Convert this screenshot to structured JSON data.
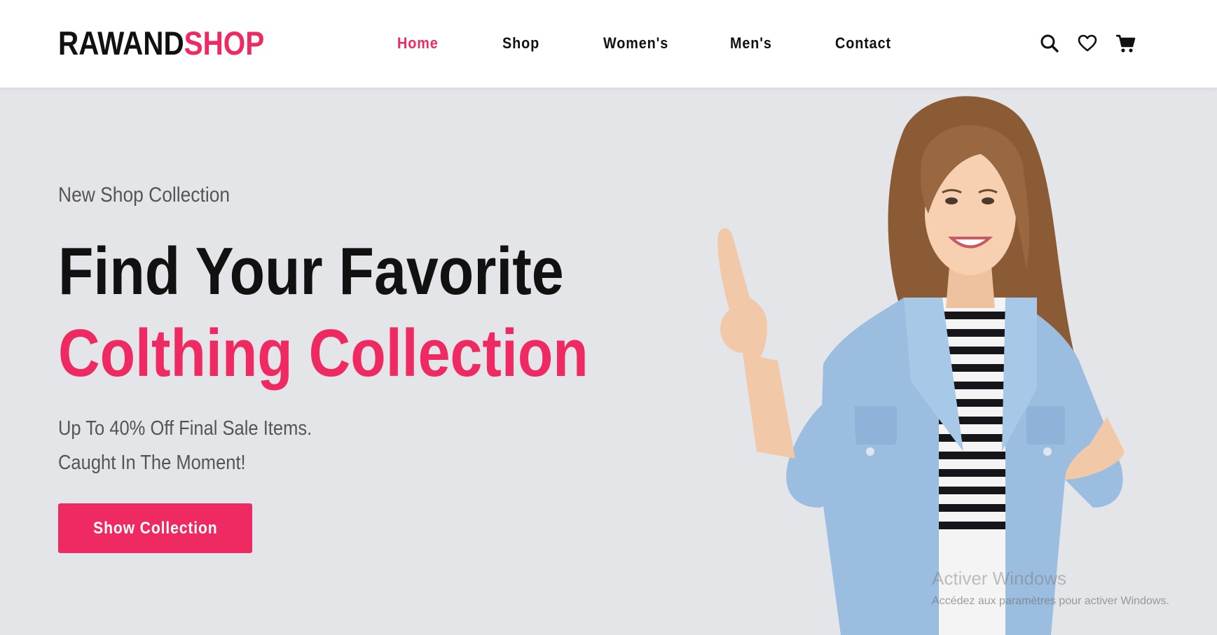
{
  "brand": {
    "part1": "RAWAND",
    "part2": "SHOP",
    "accent_color": "#ef2a62"
  },
  "nav": {
    "items": [
      {
        "label": "Home",
        "active": true
      },
      {
        "label": "Shop",
        "active": false
      },
      {
        "label": "Women's",
        "active": false
      },
      {
        "label": "Men's",
        "active": false
      },
      {
        "label": "Contact",
        "active": false
      }
    ]
  },
  "header_icons": [
    "search-icon",
    "heart-icon",
    "cart-icon"
  ],
  "hero": {
    "kicker": "New Shop Collection",
    "headline_line1": "Find Your Favorite",
    "headline_line2": "Colthing Collection",
    "subtext_line1": "Up To 40% Off Final Sale Items.",
    "subtext_line2": "Caught In The Moment!",
    "cta_label": "Show Collection",
    "background_color": "#e3e5e9"
  },
  "watermark": {
    "title": "Activer Windows",
    "subtitle": "Accédez aux paramètres pour activer Windows."
  }
}
